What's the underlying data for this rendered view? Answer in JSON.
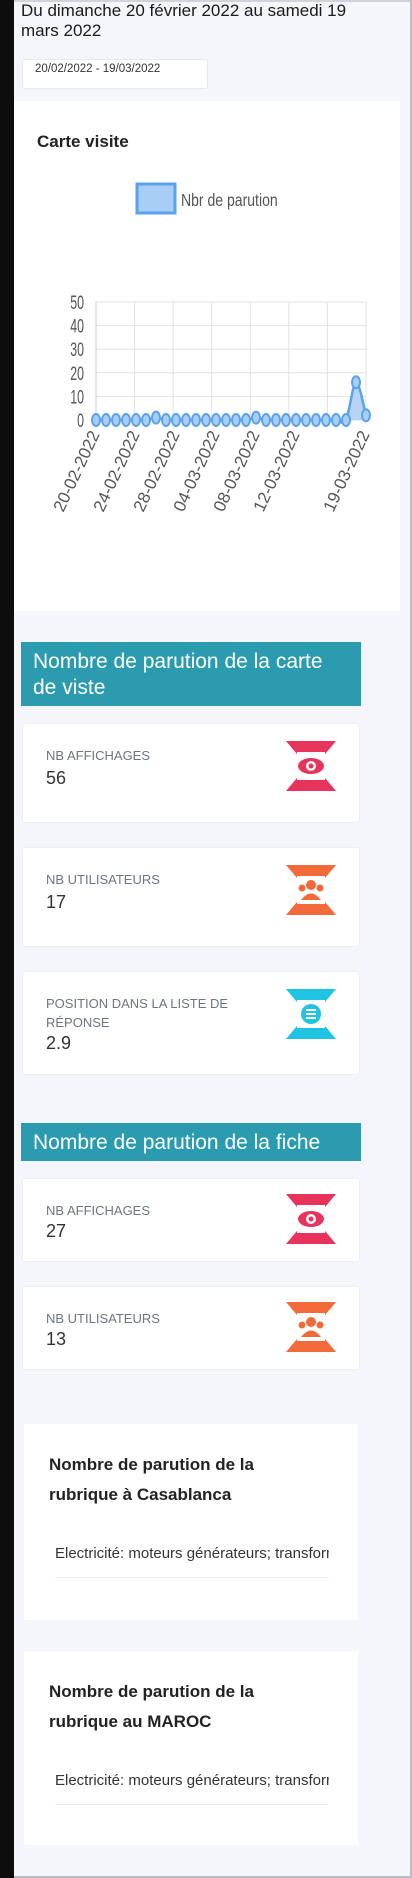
{
  "header": {
    "period_title": "Du dimanche 20 février 2022 au samedi 19 mars 2022",
    "date_range_value": "20/02/2022 - 19/03/2022"
  },
  "chart_card": {
    "title": "Carte visite"
  },
  "chart_data": {
    "type": "line",
    "title": "",
    "xlabel": "",
    "ylabel": "",
    "legend": {
      "placement": "top-center"
    },
    "grid": true,
    "ylim": [
      0,
      50
    ],
    "yticks": [
      "0",
      "10",
      "20",
      "30",
      "40",
      "50"
    ],
    "x": [
      "20-02-2022",
      "21-02-2022",
      "22-02-2022",
      "23-02-2022",
      "24-02-2022",
      "25-02-2022",
      "26-02-2022",
      "27-02-2022",
      "28-02-2022",
      "01-03-2022",
      "02-03-2022",
      "03-03-2022",
      "04-03-2022",
      "05-03-2022",
      "06-03-2022",
      "07-03-2022",
      "08-03-2022",
      "09-03-2022",
      "10-03-2022",
      "11-03-2022",
      "12-03-2022",
      "13-03-2022",
      "14-03-2022",
      "15-03-2022",
      "16-03-2022",
      "17-03-2022",
      "18-03-2022",
      "19-03-2022"
    ],
    "xtick_labels": [
      "20-02-2022",
      "24-02-2022",
      "28-02-2022",
      "04-03-2022",
      "08-03-2022",
      "12-03-2022",
      "19-03-2022"
    ],
    "series": [
      {
        "name": "Nbr de parution",
        "color": "#5aa2ea",
        "fill": "#a9cef5",
        "values": [
          0,
          0,
          0,
          0,
          0,
          0,
          1,
          0,
          0,
          0,
          0,
          0,
          0,
          0,
          0,
          0,
          1,
          0,
          0,
          0,
          0,
          0,
          0,
          0,
          0,
          0,
          16,
          2
        ]
      }
    ]
  },
  "carte_section": {
    "title": "Nombre de parution de la carte de viste",
    "stats": [
      {
        "label": "NB AFFICHAGES",
        "value": "56",
        "icon": "eye-icon",
        "color": "#e8345c"
      },
      {
        "label": "NB UTILISATEURS",
        "value": "17",
        "icon": "users-icon",
        "color": "#f2693a"
      },
      {
        "label": "POSITION DANS LA LISTE DE RÉPONSE",
        "value": "2.9",
        "icon": "list-icon",
        "color": "#21c3e2"
      }
    ]
  },
  "fiche_section": {
    "title": "Nombre de parution de la fiche",
    "stats": [
      {
        "label": "NB AFFICHAGES",
        "value": "27",
        "icon": "eye-icon",
        "color": "#e8345c"
      },
      {
        "label": "NB UTILISATEURS",
        "value": "13",
        "icon": "users-icon",
        "color": "#f2693a"
      }
    ]
  },
  "rubrique_casablanca": {
    "title": "Nombre de parution de la rubrique à Casablanca",
    "item": "Electricité: moteurs générateurs; transformateurs"
  },
  "rubrique_maroc": {
    "title": "Nombre de parution de la rubrique au MAROC",
    "item": "Electricité: moteurs générateurs; transformateurs"
  }
}
